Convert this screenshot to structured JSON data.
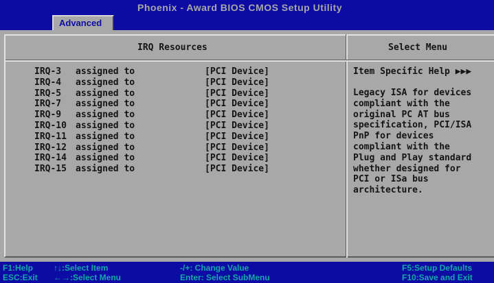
{
  "window": {
    "app_title": "Phoenix - Award BIOS CMOS Setup Utility",
    "active_tab": "Advanced"
  },
  "left_panel": {
    "title": "IRQ Resources",
    "rows": [
      {
        "irq": "IRQ-3",
        "assign": "assigned to",
        "value": "[PCI Device]"
      },
      {
        "irq": "IRQ-4",
        "assign": "assigned to",
        "value": "[PCI Device]"
      },
      {
        "irq": "IRQ-5",
        "assign": "assigned to",
        "value": "[PCI Device]"
      },
      {
        "irq": "IRQ-7",
        "assign": "assigned to",
        "value": "[PCI Device]"
      },
      {
        "irq": "IRQ-9",
        "assign": "assigned to",
        "value": "[PCI Device]"
      },
      {
        "irq": "IRQ-10",
        "assign": "assigned to",
        "value": "[PCI Device]"
      },
      {
        "irq": "IRQ-11",
        "assign": "assigned to",
        "value": "[PCI Device]"
      },
      {
        "irq": "IRQ-12",
        "assign": "assigned to",
        "value": "[PCI Device]"
      },
      {
        "irq": "IRQ-14",
        "assign": "assigned to",
        "value": "[PCI Device]"
      },
      {
        "irq": "IRQ-15",
        "assign": "assigned to",
        "value": "[PCI Device]"
      }
    ]
  },
  "right_panel": {
    "title": "Select Menu",
    "help_heading": "Item Specific Help ▶▶▶",
    "help_text": "Legacy ISA for devices\ncompliant with the\noriginal PC AT bus\nspecification, PCI/ISA\nPnP for devices\ncompliant with the\nPlug and Play standard\nwhether designed for\nPCI or ISa bus\narchitecture."
  },
  "footer": {
    "f1": "F1:Help",
    "esc": "ESC:Exit",
    "select_item": "↑↓:Select Item",
    "select_menu": "←→:Select Menu",
    "change_value": "-/+: Change Value",
    "select_submenu": "Enter: Select SubMenu",
    "f5": "F5:Setup Defaults",
    "f10": "F10:Save and Exit"
  },
  "colors": {
    "background": "#a8a8a8",
    "bar": "#0c0ca4",
    "footer_text": "#14a8a8",
    "text": "#141414"
  }
}
